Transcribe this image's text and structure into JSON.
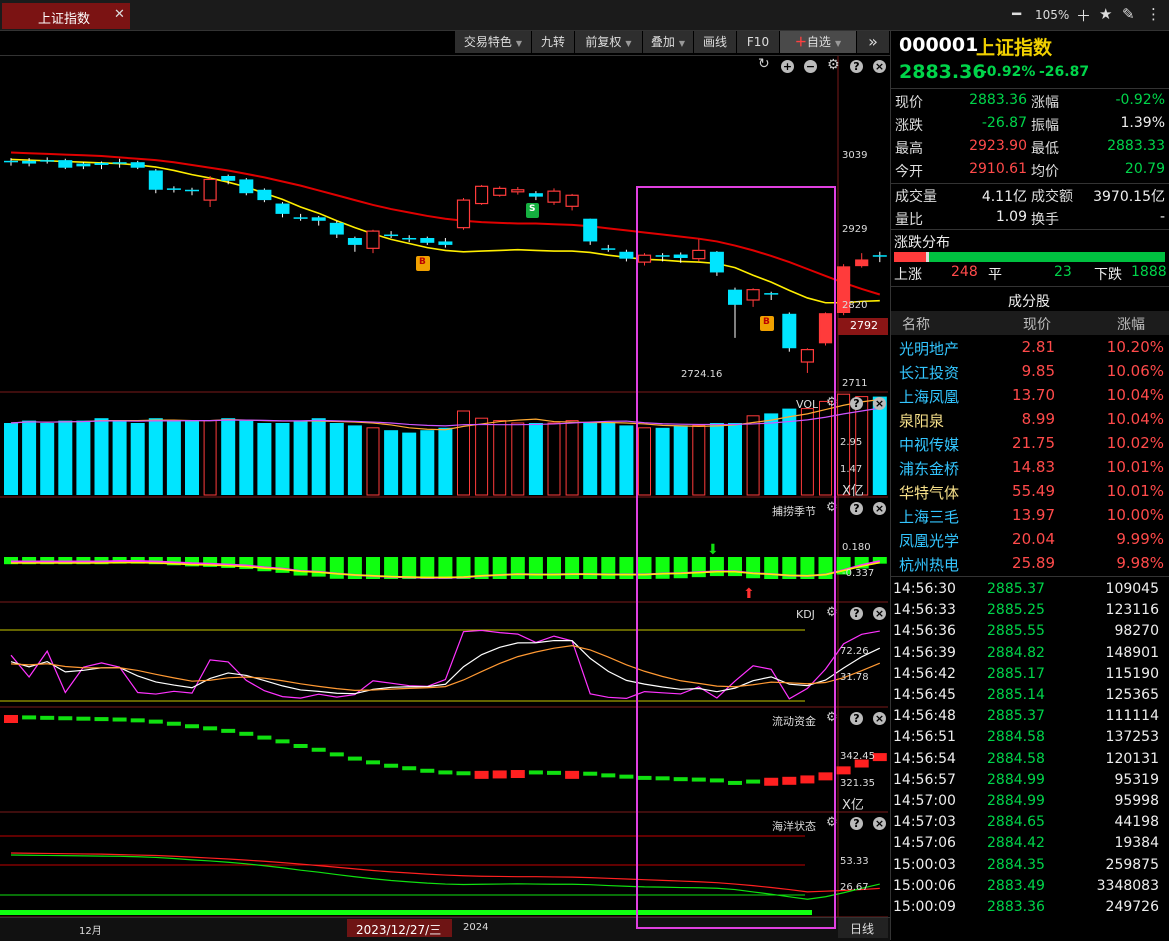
{
  "window": {
    "tab_label": "上证指数",
    "zoom": "105%"
  },
  "toolbar": {
    "buttons": [
      "交易特色",
      "九转",
      "前复权",
      "叠加",
      "画线",
      "F10",
      "自选"
    ],
    "more": "»"
  },
  "chart": {
    "price_axis": [
      "3039",
      "2929",
      "2820",
      "2711"
    ],
    "current_price_tag": "2792",
    "low_label": "2724.16",
    "buy_signal": "B",
    "sell_signal": "S",
    "vol": {
      "label": "VOL",
      "axis": [
        "2.95",
        "1.47",
        "X亿"
      ]
    },
    "bushao": {
      "label": "捕捞季节",
      "axis": [
        "0.180",
        "-0.337"
      ]
    },
    "kdj": {
      "label": "KDJ",
      "axis": [
        "72.26",
        "31.78"
      ]
    },
    "liquidity": {
      "label": "流动资金",
      "axis": [
        "342.45",
        "321.35",
        "X亿"
      ]
    },
    "ocean": {
      "label": "海洋状态",
      "axis": [
        "53.33",
        "26.67"
      ]
    },
    "time_axis": {
      "month_label": "12月",
      "cursor_date": "2023/12/27/三",
      "year_label": "2024",
      "period": "日线"
    },
    "colors": {
      "up": "#ff3b3b",
      "down": "#00e5ff",
      "ma_red": "#e00000",
      "ma_yellow": "#ffee00",
      "highlight": "#e040e0"
    },
    "candles": [
      [
        3030,
        3032,
        3025,
        3036,
        0
      ],
      [
        3032,
        3028,
        3024,
        3036,
        0
      ],
      [
        3031,
        3033,
        3028,
        3037,
        0
      ],
      [
        3033,
        3022,
        3020,
        3035,
        0
      ],
      [
        3024,
        3028,
        3020,
        3030,
        0
      ],
      [
        3026,
        3029,
        3020,
        3031,
        0
      ],
      [
        3030,
        3028,
        3022,
        3035,
        0
      ],
      [
        3030,
        3022,
        3020,
        3032,
        0
      ],
      [
        3018,
        2990,
        2985,
        3020,
        0
      ],
      [
        2990,
        2992,
        2986,
        2995,
        0
      ],
      [
        2990,
        2988,
        2982,
        2993,
        0
      ],
      [
        2975,
        3005,
        2965,
        3010,
        1
      ],
      [
        3010,
        3003,
        2998,
        3012,
        0
      ],
      [
        3005,
        2985,
        2982,
        3007,
        0
      ],
      [
        2990,
        2975,
        2972,
        2992,
        0
      ],
      [
        2970,
        2955,
        2950,
        2972,
        0
      ],
      [
        2950,
        2948,
        2945,
        2955,
        0
      ],
      [
        2950,
        2945,
        2938,
        2952,
        0
      ],
      [
        2942,
        2925,
        2920,
        2945,
        0
      ],
      [
        2920,
        2910,
        2900,
        2922,
        0
      ],
      [
        2905,
        2930,
        2898,
        2932,
        1
      ],
      [
        2925,
        2925,
        2920,
        2930,
        0
      ],
      [
        2920,
        2918,
        2914,
        2924,
        0
      ],
      [
        2920,
        2913,
        2910,
        2922,
        0
      ],
      [
        2910,
        2915,
        2906,
        2920,
        0
      ],
      [
        2935,
        2975,
        2932,
        2978,
        1
      ],
      [
        2970,
        2995,
        2968,
        2997,
        1
      ],
      [
        2982,
        2992,
        2980,
        2995,
        1
      ],
      [
        2987,
        2990,
        2983,
        2994,
        1
      ],
      [
        2985,
        2980,
        2975,
        2988,
        0
      ],
      [
        2972,
        2988,
        2968,
        2992,
        1
      ],
      [
        2966,
        2982,
        2960,
        2984,
        1
      ],
      [
        2948,
        2915,
        2910,
        2948,
        0
      ],
      [
        2905,
        2905,
        2900,
        2910,
        0
      ],
      [
        2900,
        2890,
        2886,
        2903,
        0
      ],
      [
        2885,
        2895,
        2880,
        2898,
        1
      ],
      [
        2895,
        2893,
        2886,
        2898,
        0
      ],
      [
        2896,
        2891,
        2884,
        2899,
        0
      ],
      [
        2890,
        2902,
        2886,
        2918,
        1
      ],
      [
        2900,
        2870,
        2865,
        2901,
        0
      ],
      [
        2845,
        2823,
        2775,
        2848,
        0
      ],
      [
        2830,
        2845,
        2820,
        2847,
        1
      ],
      [
        2840,
        2838,
        2830,
        2842,
        0
      ],
      [
        2810,
        2760,
        2755,
        2812,
        0
      ],
      [
        2740,
        2758,
        2724.16,
        2760,
        1
      ],
      [
        2768,
        2810,
        2764,
        2812,
        1
      ],
      [
        2812,
        2878,
        2808,
        2882,
        1
      ],
      [
        2880,
        2888,
        2877,
        2898,
        1
      ],
      [
        2895,
        2895,
        2885,
        2900,
        0
      ]
    ],
    "ma_yellow": [
      3034,
      3033,
      3032,
      3031,
      3030,
      3029,
      3028,
      3026,
      3023,
      3018,
      3012,
      3007,
      3001,
      2994,
      2985,
      2976,
      2965,
      2956,
      2945,
      2935,
      2926,
      2918,
      2912,
      2906,
      2902,
      2900,
      2901,
      2902,
      2903,
      2902,
      2901,
      2901,
      2899,
      2895,
      2892,
      2889,
      2888,
      2886,
      2885,
      2883,
      2877,
      2866,
      2856,
      2844,
      2833,
      2826,
      2826,
      2828,
      2829
    ],
    "ma_red": [
      3044,
      3043,
      3042,
      3041,
      3040,
      3039,
      3037,
      3035,
      3033,
      3030,
      3026,
      3022,
      3018,
      3013,
      3008,
      3002,
      2996,
      2989,
      2982,
      2975,
      2968,
      2962,
      2957,
      2952,
      2948,
      2945,
      2943,
      2942,
      2941,
      2941,
      2940,
      2939,
      2937,
      2934,
      2931,
      2928,
      2925,
      2922,
      2919,
      2915,
      2909,
      2902,
      2894,
      2885,
      2875,
      2865,
      2855,
      2846,
      2838
    ],
    "volumes": [
      3.0,
      3.1,
      3.0,
      3.1,
      3.1,
      3.2,
      3.1,
      3.0,
      3.2,
      3.1,
      3.1,
      3.1,
      3.2,
      3.1,
      3.0,
      3.0,
      3.1,
      3.2,
      3.0,
      2.9,
      2.8,
      2.7,
      2.6,
      2.7,
      2.8,
      3.5,
      3.2,
      3.1,
      3.0,
      3.0,
      3.0,
      3.1,
      3.0,
      3.0,
      2.9,
      2.8,
      2.8,
      2.9,
      2.9,
      3.0,
      3.0,
      3.3,
      3.4,
      3.6,
      3.6,
      3.9,
      4.2,
      4.1,
      4.1
    ]
  },
  "quote": {
    "code": "000001",
    "name": "上证指数",
    "price": "2883.36",
    "change_pct": "-0.92%",
    "change": "-26.87",
    "fields": [
      {
        "k": "现价",
        "v": "2883.36",
        "k2": "涨幅",
        "v2": "-0.92%"
      },
      {
        "k": "涨跌",
        "v": "-26.87",
        "k2": "振幅",
        "v2": "1.39%"
      },
      {
        "k": "最高",
        "v": "2923.90",
        "k2": "最低",
        "v2": "2883.33"
      },
      {
        "k": "今开",
        "v": "2910.61",
        "k2": "均价",
        "v2": "20.79"
      },
      {
        "k": "成交量",
        "v": "4.11亿",
        "k2": "成交额",
        "v2": "3970.15亿"
      },
      {
        "k": "量比",
        "v": "1.09",
        "k2": "换手",
        "v2": "-"
      }
    ],
    "distribution": {
      "title": "涨跌分布",
      "up_label": "上涨",
      "up": "248",
      "flat_label": "平",
      "flat": "23",
      "down_label": "下跌",
      "down": "1888"
    },
    "constituents_title": "成分股",
    "table_headers": [
      "名称",
      "现价",
      "涨幅"
    ],
    "constituents": [
      {
        "name": "光明地产",
        "price": "2.81",
        "pct": "10.20%"
      },
      {
        "name": "长江投资",
        "price": "9.85",
        "pct": "10.06%"
      },
      {
        "name": "上海凤凰",
        "price": "13.70",
        "pct": "10.04%"
      },
      {
        "name": "泉阳泉",
        "price": "8.99",
        "pct": "10.04%"
      },
      {
        "name": "中视传媒",
        "price": "21.75",
        "pct": "10.02%"
      },
      {
        "name": "浦东金桥",
        "price": "14.83",
        "pct": "10.01%"
      },
      {
        "name": "华特气体",
        "price": "55.49",
        "pct": "10.01%"
      },
      {
        "name": "上海三毛",
        "price": "13.97",
        "pct": "10.00%"
      },
      {
        "name": "凤凰光学",
        "price": "20.04",
        "pct": "9.99%"
      },
      {
        "name": "杭州热电",
        "price": "25.89",
        "pct": "9.98%"
      }
    ],
    "ticks": [
      {
        "t": "14:56:30",
        "p": "2885.37",
        "v": "109045"
      },
      {
        "t": "14:56:33",
        "p": "2885.25",
        "v": "123116"
      },
      {
        "t": "14:56:36",
        "p": "2885.55",
        "v": "98270"
      },
      {
        "t": "14:56:39",
        "p": "2884.82",
        "v": "148901"
      },
      {
        "t": "14:56:42",
        "p": "2885.17",
        "v": "115190"
      },
      {
        "t": "14:56:45",
        "p": "2885.14",
        "v": "125365"
      },
      {
        "t": "14:56:48",
        "p": "2885.37",
        "v": "111114"
      },
      {
        "t": "14:56:51",
        "p": "2884.58",
        "v": "137253"
      },
      {
        "t": "14:56:54",
        "p": "2884.58",
        "v": "120131"
      },
      {
        "t": "14:56:57",
        "p": "2884.99",
        "v": "95319"
      },
      {
        "t": "14:57:00",
        "p": "2884.99",
        "v": "95998"
      },
      {
        "t": "14:57:03",
        "p": "2884.65",
        "v": "44198"
      },
      {
        "t": "14:57:06",
        "p": "2884.42",
        "v": "19384"
      },
      {
        "t": "15:00:03",
        "p": "2884.35",
        "v": "259875"
      },
      {
        "t": "15:00:06",
        "p": "2883.49",
        "v": "3348083"
      },
      {
        "t": "15:00:09",
        "p": "2883.36",
        "v": "249726"
      }
    ]
  }
}
